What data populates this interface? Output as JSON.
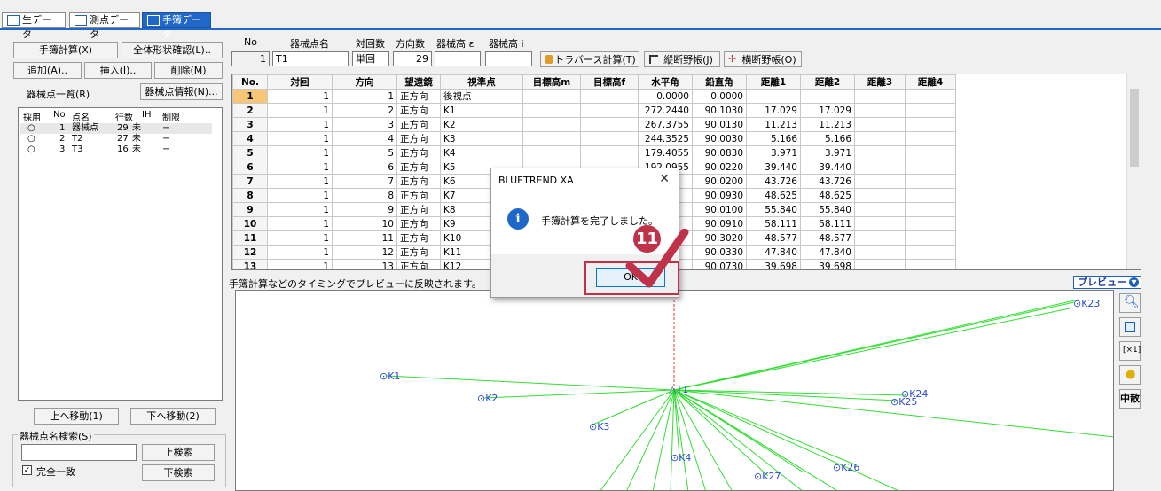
{
  "tabs": [
    {
      "label": "生データ"
    },
    {
      "label": "測点データ"
    },
    {
      "label": "手簿データ"
    }
  ],
  "left": {
    "calc_btn": "手簿計算(X)",
    "shape_btn": "全体形状確認(L)..",
    "add_btn": "追加(A)..",
    "insert_btn": "挿入(I)..",
    "delete_btn": "削除(M)",
    "station_list_label": "器械点一覧(R)",
    "station_info_btn": "器械点情報(N)...",
    "list_headers": [
      "採用",
      "No",
      "点名",
      "行数",
      "IH",
      "制限"
    ],
    "list_rows": [
      {
        "use": "○",
        "no": "1",
        "name": "器械点",
        "rows": "29",
        "ih": "未",
        "limit": "−"
      },
      {
        "use": "○",
        "no": "2",
        "name": "T2",
        "rows": "27",
        "ih": "未",
        "limit": "−"
      },
      {
        "use": "○",
        "no": "3",
        "name": "T3",
        "rows": "16",
        "ih": "未",
        "limit": "−"
      }
    ],
    "move_up_btn": "上へ移動(1)",
    "move_down_btn": "下へ移動(2)",
    "search_group_label": "器械点名検索(S)",
    "search_value": "",
    "search_up_btn": "上検索",
    "search_down_btn": "下検索",
    "exact_match_label": "完全一致",
    "exact_match_checked": true
  },
  "header": {
    "labels": {
      "no": "No",
      "station_name": "器械点名",
      "pairs": "対回数",
      "directions": "方向数",
      "height_e": "器械高 ε",
      "height_i": "器械高 i"
    },
    "no_value": "1",
    "name_value": "T1",
    "pairs_value": "単回",
    "directions_value": "29",
    "height_e_value": "",
    "height_i_value": "",
    "traverse_btn": "トラバース計算(T)",
    "vertical_btn": "縦断野帳(J)",
    "horizontal_btn": "横断野帳(O)"
  },
  "table": {
    "columns": [
      "No.",
      "対回",
      "方向",
      "望遠鏡",
      "視準点",
      "目標高m",
      "目標高f",
      "水平角",
      "鉛直角",
      "距離1",
      "距離2",
      "距離3",
      "距離4"
    ],
    "rows": [
      [
        "1",
        "1",
        "1",
        "正方向",
        "後視点",
        "",
        "",
        "0.0000",
        "0.0000",
        "",
        "",
        "",
        ""
      ],
      [
        "2",
        "1",
        "2",
        "正方向",
        "K1",
        "",
        "",
        "272.2440",
        "90.1030",
        "17.029",
        "17.029",
        "",
        ""
      ],
      [
        "3",
        "1",
        "3",
        "正方向",
        "K2",
        "",
        "",
        "267.3755",
        "90.0130",
        "11.213",
        "11.213",
        "",
        ""
      ],
      [
        "4",
        "1",
        "4",
        "正方向",
        "K3",
        "",
        "",
        "244.3525",
        "90.0030",
        "5.166",
        "5.166",
        "",
        ""
      ],
      [
        "5",
        "1",
        "5",
        "正方向",
        "K4",
        "",
        "",
        "179.4055",
        "90.0830",
        "3.971",
        "3.971",
        "",
        ""
      ],
      [
        "6",
        "1",
        "6",
        "正方向",
        "K5",
        "",
        "",
        "192.0955",
        "90.0220",
        "39.440",
        "39.440",
        "",
        ""
      ],
      [
        "7",
        "1",
        "7",
        "正方向",
        "K6",
        "",
        "",
        "",
        "90.0200",
        "43.726",
        "43.726",
        "",
        ""
      ],
      [
        "8",
        "1",
        "8",
        "正方向",
        "K7",
        "",
        "",
        "",
        "90.0930",
        "48.625",
        "48.625",
        "",
        ""
      ],
      [
        "9",
        "1",
        "9",
        "正方向",
        "K8",
        "",
        "",
        "",
        "90.0100",
        "55.840",
        "55.840",
        "",
        ""
      ],
      [
        "10",
        "1",
        "10",
        "正方向",
        "K9",
        "",
        "",
        "",
        "90.0910",
        "58.111",
        "58.111",
        "",
        ""
      ],
      [
        "11",
        "1",
        "11",
        "正方向",
        "K10",
        "",
        "",
        "",
        "90.3020",
        "48.577",
        "48.577",
        "",
        ""
      ],
      [
        "12",
        "1",
        "12",
        "正方向",
        "K11",
        "",
        "",
        "",
        "90.0330",
        "47.840",
        "47.840",
        "",
        ""
      ],
      [
        "13",
        "1",
        "13",
        "正方向",
        "K12",
        "",
        "",
        "",
        "90.0730",
        "39.698",
        "39.698",
        "",
        ""
      ]
    ]
  },
  "preview": {
    "note": "手簿計算などのタイミングでプレビューに反映されます。",
    "label": "プレビュー",
    "mode_btn": "中散",
    "station": "T1",
    "points": [
      "K1",
      "K2",
      "K3",
      "K4",
      "K23",
      "K24",
      "K25",
      "K26",
      "K27"
    ]
  },
  "dialog": {
    "title": "BLUETREND XA",
    "message": "手簿計算を完了しました。",
    "ok_btn": "OK",
    "step_number": "11",
    "accent": "#c0314a"
  }
}
